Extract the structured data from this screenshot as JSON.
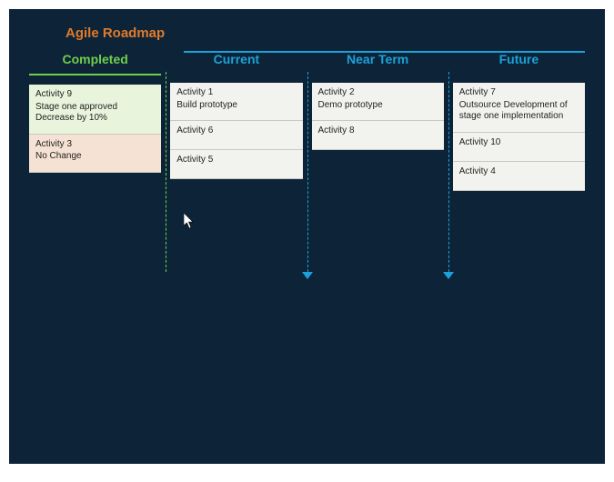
{
  "title": "Agile Roadmap",
  "lanes": {
    "completed": {
      "header": "Completed",
      "cards": [
        {
          "title": "Activity 9",
          "desc": "Stage one approved\nDecrease by 10%"
        },
        {
          "title": "Activity 3",
          "desc": "No Change"
        }
      ]
    },
    "current": {
      "header": "Current",
      "cards": [
        {
          "title": "Activity 1",
          "desc": "Build prototype"
        },
        {
          "title": "Activity 6",
          "desc": ""
        },
        {
          "title": "Activity 5",
          "desc": ""
        }
      ]
    },
    "near": {
      "header": "Near Term",
      "cards": [
        {
          "title": "Activity 2",
          "desc": "Demo prototype"
        },
        {
          "title": "Activity 8",
          "desc": ""
        }
      ]
    },
    "future": {
      "header": "Future",
      "cards": [
        {
          "title": "Activity 7",
          "desc": "Outsource Development of stage one implementation"
        },
        {
          "title": "Activity 10",
          "desc": ""
        },
        {
          "title": "Activity 4",
          "desc": ""
        }
      ]
    }
  }
}
